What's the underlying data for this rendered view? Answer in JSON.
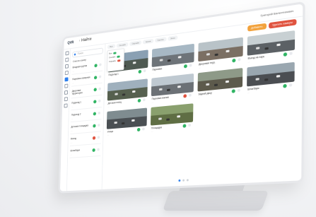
{
  "app": {
    "logo": "QVR",
    "breadcrumb": "Найти",
    "user": "Григорий Валентинович"
  },
  "toolbar": {
    "primary_label": "Добавить",
    "danger_label": "Удалить камеры"
  },
  "sidebar": {
    "search_placeholder": "Поиск",
    "header": "Список камер",
    "items": [
      {
        "title": "Входная группа",
        "sub": "···",
        "status": "green"
      },
      {
        "title": "Парковка северная",
        "sub": "···",
        "status": "green"
      },
      {
        "title": "Дворовая территория",
        "sub": "···",
        "status": "green"
      },
      {
        "title": "Подъезд 1",
        "sub": "···",
        "status": "green"
      },
      {
        "title": "Подъезд 2",
        "sub": "···",
        "status": "green"
      },
      {
        "title": "Детская площадка",
        "sub": "···",
        "status": "green"
      },
      {
        "title": "Въезд",
        "sub": "···",
        "status": "red"
      },
      {
        "title": "Шлагбаум",
        "sub": "···",
        "status": "green"
      }
    ]
  },
  "filters": [
    "Все",
    "Онлайн",
    "Офлайн",
    "Архив",
    "Группы",
    "Зоны"
  ],
  "popup": {
    "items": [
      "Все",
      "Онлайн",
      "Офлайн"
    ]
  },
  "cameras": [
    {
      "title": "Подъезд 1",
      "sub": "···",
      "status": "green",
      "sky": "#8aa0b3",
      "ground": "#4f5a52"
    },
    {
      "title": "Парковка",
      "sub": "···",
      "status": "green",
      "sky": "#a7b8c4",
      "ground": "#6e7479"
    },
    {
      "title": "Дворовая терр.",
      "sub": "···",
      "status": "green",
      "sky": "#b9c3c8",
      "ground": "#7b6f63"
    },
    {
      "title": "Въезд на парк.",
      "sub": "···",
      "status": "green",
      "sky": "#c8d0d3",
      "ground": "#5c6165"
    },
    {
      "title": "Детская площ.",
      "sub": "···",
      "status": "green",
      "sky": "#9fb0bd",
      "ground": "#56604f"
    },
    {
      "title": "Парковка южная",
      "sub": "···",
      "status": "red",
      "sky": "#bfc9d1",
      "ground": "#6c7176"
    },
    {
      "title": "Задний двор",
      "sub": "···",
      "status": "green",
      "sky": "#8e9a88",
      "ground": "#5d5a4c"
    },
    {
      "title": "Шлагбаум",
      "sub": "···",
      "status": "green",
      "sky": "#9aa7b0",
      "ground": "#4b4e52"
    },
    {
      "title": "Улица",
      "sub": "···",
      "status": "green",
      "sky": "#7f8c90",
      "ground": "#4a4f53"
    },
    {
      "title": "Площадка",
      "sub": "···",
      "status": "green",
      "sky": "#8aa06e",
      "ground": "#5f6e44"
    }
  ],
  "colors": {
    "accent": "#2f80ed",
    "online": "#2fb463",
    "offline": "#e0533f",
    "warn": "#f2a23c"
  }
}
